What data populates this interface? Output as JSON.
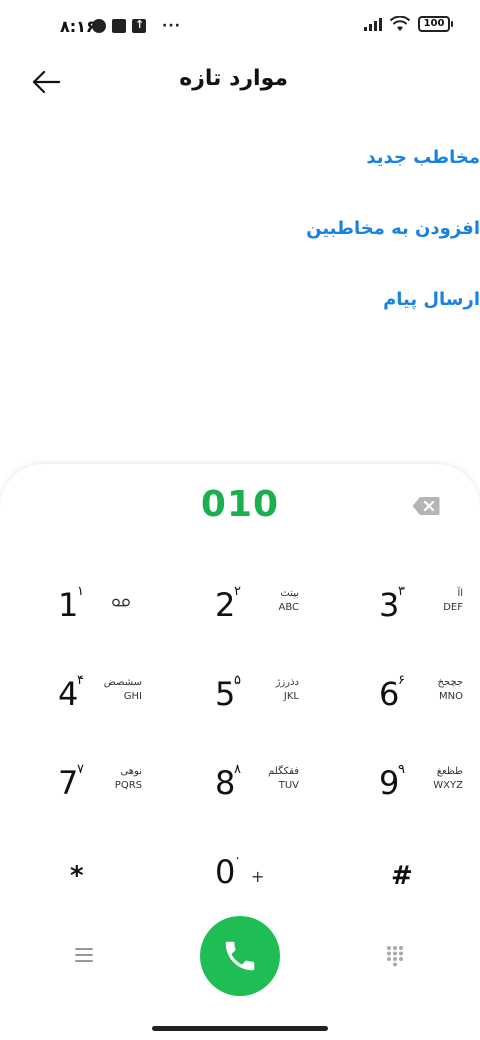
{
  "status_bar": {
    "time": "۸:۱۶",
    "battery": "100"
  },
  "header": {
    "title": "موارد تازه"
  },
  "options": [
    {
      "label": "مخاطب جدید"
    },
    {
      "label": "افزودن به مخاطبین"
    },
    {
      "label": "ارسال پیام"
    }
  ],
  "dialer": {
    "number": "010",
    "keys": [
      {
        "digit": "1",
        "pdigit": "۱",
        "pletters": "",
        "eletters": ""
      },
      {
        "digit": "2",
        "pdigit": "۲",
        "pletters": "بپتث",
        "eletters": "ABC"
      },
      {
        "digit": "3",
        "pdigit": "۳",
        "pletters": "اآ",
        "eletters": "DEF"
      },
      {
        "digit": "4",
        "pdigit": "۴",
        "pletters": "سشصض",
        "eletters": "GHI"
      },
      {
        "digit": "5",
        "pdigit": "۵",
        "pletters": "دذرزژ",
        "eletters": "JKL"
      },
      {
        "digit": "6",
        "pdigit": "۶",
        "pletters": "جچحخ",
        "eletters": "MNO"
      },
      {
        "digit": "7",
        "pdigit": "۷",
        "pletters": "نوهی",
        "eletters": "PQRS"
      },
      {
        "digit": "8",
        "pdigit": "۸",
        "pletters": "فقکگلم",
        "eletters": "TUV"
      },
      {
        "digit": "9",
        "pdigit": "۹",
        "pletters": "طظعغ",
        "eletters": "WXYZ"
      }
    ],
    "star": "*",
    "zero": {
      "digit": "0",
      "pdigit": "۰",
      "extra": "+"
    },
    "hash": "#"
  },
  "colors": {
    "accent_blue": "#1a82e0",
    "number_green": "#1ab04f",
    "call_green": "#1fbe54"
  },
  "icons": {
    "back": "arrow-left-icon",
    "backspace": "backspace-icon",
    "menu": "menu-icon",
    "call": "phone-icon",
    "keypad": "keypad-grid-icon",
    "voicemail": "voicemail-icon"
  }
}
